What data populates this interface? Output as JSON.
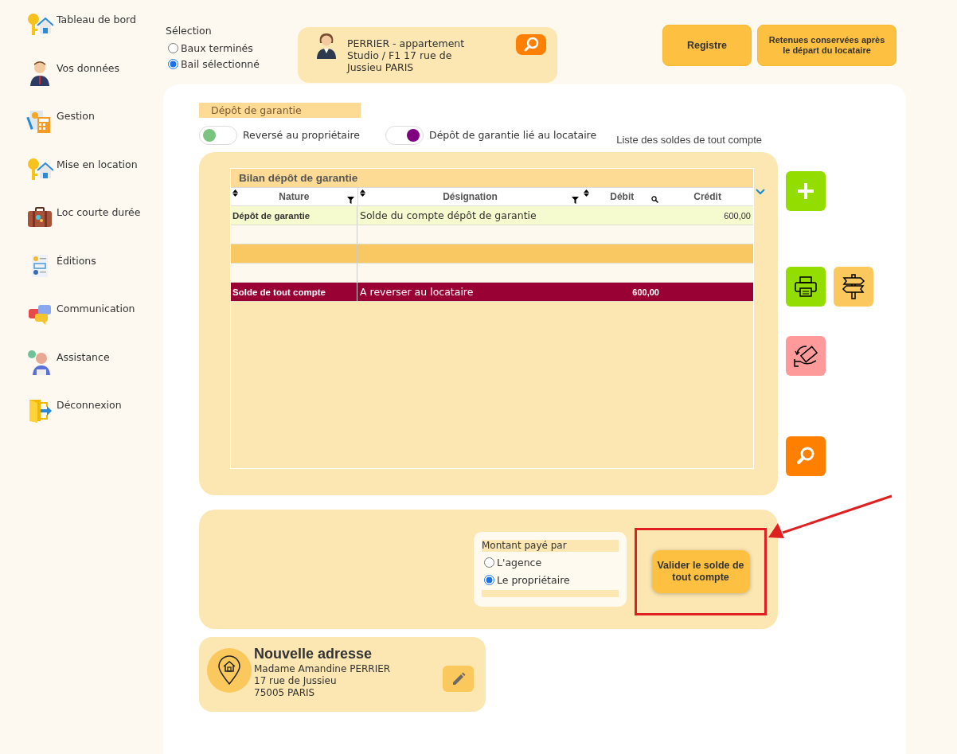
{
  "sidebar": {
    "items": [
      {
        "label": "Tableau de bord"
      },
      {
        "label": "Vos données"
      },
      {
        "label": "Gestion"
      },
      {
        "label": "Mise en location"
      },
      {
        "label": "Loc courte durée"
      },
      {
        "label": "Éditions"
      },
      {
        "label": "Communication"
      },
      {
        "label": "Assistance"
      },
      {
        "label": "Déconnexion"
      }
    ]
  },
  "selection": {
    "label": "Sélection",
    "options": [
      {
        "label": "Baux terminés",
        "selected": false
      },
      {
        "label": "Bail sélectionné",
        "selected": true
      }
    ]
  },
  "tenant": {
    "lines": [
      "PERRIER - appartement",
      "Studio / F1 17 rue de",
      "Jussieu PARIS"
    ]
  },
  "top_buttons": [
    "Registre",
    "Retenues conservées après le départ du locataire"
  ],
  "deposit": {
    "section_title": "Dépôt de garantie",
    "toggles": [
      {
        "label": "Reversé au propriétaire",
        "on": false
      },
      {
        "label": "Dépôt de garantie lié au locataire",
        "on": true
      }
    ],
    "list_title": "Liste des soldes de tout compte"
  },
  "table": {
    "title": "Bilan dépôt de garantie",
    "columns": [
      {
        "label": "Nature",
        "sortable": true,
        "filter": true,
        "search": false
      },
      {
        "label": "Désignation",
        "sortable": true,
        "filter": true,
        "search": false
      },
      {
        "label": "Débit",
        "sortable": true,
        "filter": false,
        "search": true
      },
      {
        "label": "Crédit",
        "sortable": false,
        "filter": false,
        "search": false
      }
    ],
    "rows": [
      {
        "kind": "entry",
        "nature": "Dépôt de garantie",
        "designation": "Solde du compte dépôt de garantie",
        "credit": "600,00"
      },
      {
        "kind": "blank"
      },
      {
        "kind": "band"
      },
      {
        "kind": "blank"
      },
      {
        "kind": "total",
        "nature": "Solde de tout compte",
        "designation": "A reverser au locataire",
        "debit": "600,00"
      }
    ]
  },
  "payment": {
    "title": "Montant payé par",
    "options": [
      {
        "label": "L'agence",
        "selected": false
      },
      {
        "label": "Le propriétaire",
        "selected": true
      }
    ]
  },
  "validate_button": "Valider le solde de tout compte",
  "new_address": {
    "title": "Nouvelle adresse",
    "lines": [
      "Madame Amandine PERRIER",
      "17 rue de Jussieu",
      "75005 PARIS"
    ]
  }
}
